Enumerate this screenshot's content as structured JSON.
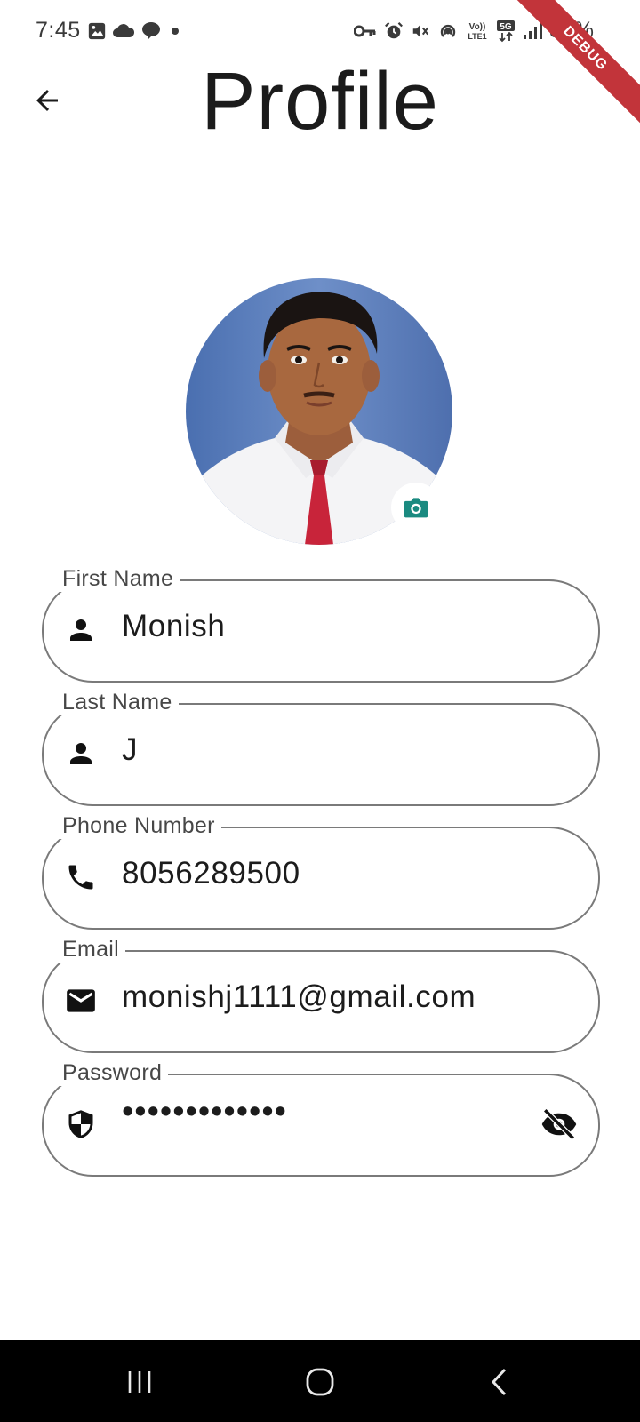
{
  "status_bar": {
    "time": "7:45",
    "battery": "30%",
    "icons": [
      "image-icon",
      "cloud-icon",
      "chat-icon",
      "dot-icon",
      "key-icon",
      "alarm-icon",
      "mute-icon",
      "hotspot-icon",
      "volte-icon",
      "5g-icon",
      "signal-icon",
      "battery-icon"
    ]
  },
  "debug_banner": {
    "label": "DEBUG",
    "color": "#c2343a"
  },
  "header": {
    "title": "Profile",
    "back_icon": "arrow-back-icon"
  },
  "avatar": {
    "camera_icon": "camera-icon",
    "camera_color": "#1a8a80"
  },
  "form": {
    "first_name": {
      "label": "First Name",
      "value": "Monish",
      "icon": "person-icon"
    },
    "last_name": {
      "label": "Last Name",
      "value": "J",
      "icon": "person-icon"
    },
    "phone": {
      "label": "Phone Number",
      "value": "8056289500",
      "icon": "phone-icon"
    },
    "email": {
      "label": "Email",
      "value": "monishj1111@gmail.com",
      "icon": "mail-icon"
    },
    "password": {
      "label": "Password",
      "value": "•••••••••••••",
      "icon": "shield-icon",
      "toggle_icon": "eye-off-icon"
    }
  },
  "nav_bar": {
    "recents_icon": "recents-icon",
    "home_icon": "home-icon",
    "back_icon": "back-chevron-icon"
  }
}
